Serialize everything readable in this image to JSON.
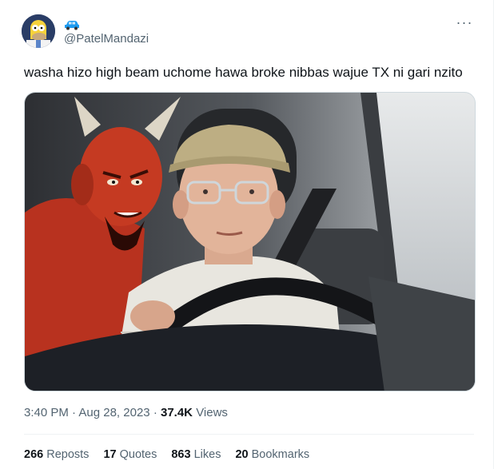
{
  "author": {
    "display_icon": "car-emoji",
    "handle": "@PatelMandazi",
    "avatar": "homer-simpson-avatar"
  },
  "tweet": {
    "text": "washa hizo high beam uchome hawa broke nibbas wajue TX ni gari nzito",
    "time": "3:40 PM",
    "separator1": "·",
    "date": "Aug 28, 2023",
    "separator2": "·",
    "views_count": "37.4K",
    "views_label": "Views"
  },
  "stats": {
    "reposts_count": "266",
    "reposts_label": "Reposts",
    "quotes_count": "17",
    "quotes_label": "Quotes",
    "likes_count": "863",
    "likes_label": "Likes",
    "bookmarks_count": "20",
    "bookmarks_label": "Bookmarks"
  },
  "more_label": "···",
  "colors": {
    "text": "#0f1419",
    "secondary": "#536471",
    "border": "#eff3f4",
    "car": "#1d9bf0"
  }
}
